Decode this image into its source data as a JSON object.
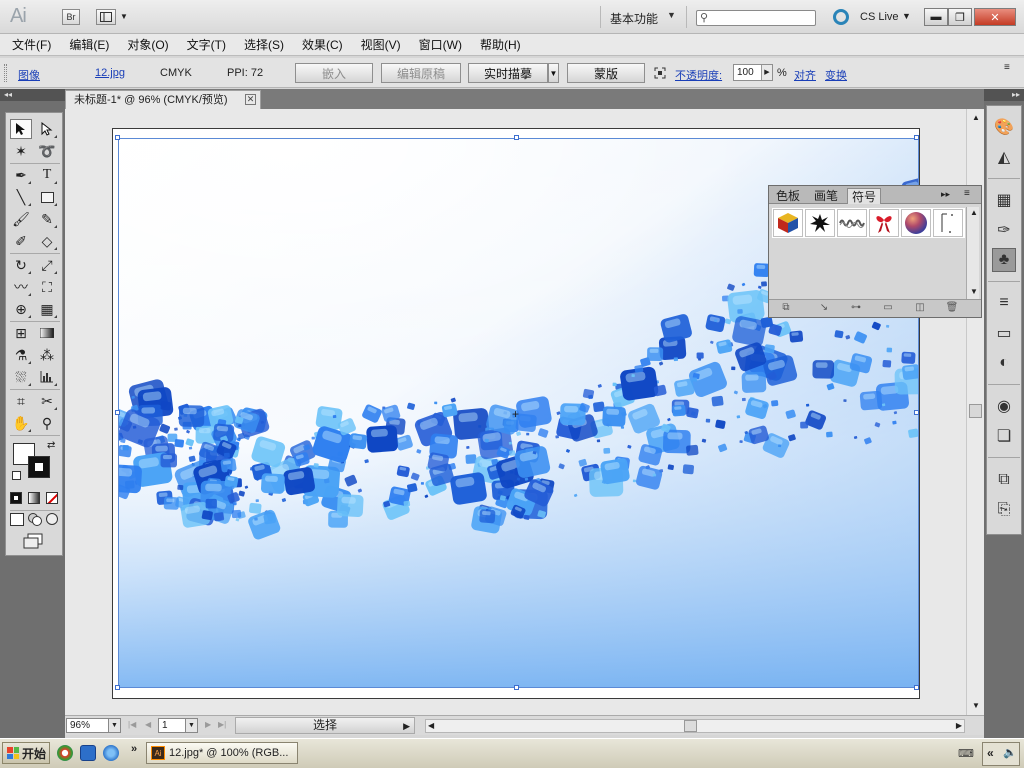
{
  "titlebar": {
    "app_logo": "Ai",
    "bridge_label": "Br",
    "workspace_label": "基本功能",
    "search_placeholder": "",
    "cslive_label": "CS Live"
  },
  "menu": [
    "文件(F)",
    "编辑(E)",
    "对象(O)",
    "文字(T)",
    "选择(S)",
    "效果(C)",
    "视图(V)",
    "窗口(W)",
    "帮助(H)"
  ],
  "control_bar": {
    "object_type": "图像",
    "file_name": "12.jpg",
    "color_mode": "CMYK",
    "ppi": "PPI: 72",
    "embed_label": "嵌入",
    "edit_original_label": "编辑原稿",
    "live_trace_label": "实时描摹",
    "mask_label": "蒙版",
    "opacity_label": "不透明度:",
    "opacity_value": "100",
    "percent": "%",
    "align_label": "对齐",
    "transform_label": "变换"
  },
  "document": {
    "tab_title": "未标题-1* @ 96% (CMYK/预览)"
  },
  "status_bar": {
    "zoom": "96%",
    "page": "1",
    "status_text": "选择"
  },
  "symbol_panel": {
    "tabs": [
      "色板",
      "画笔",
      "符号"
    ],
    "active_tab": "符号",
    "symbols": [
      "cube-symbol",
      "splat-symbol",
      "scribble-symbol",
      "ribbon-symbol",
      "sphere-symbol",
      "note-symbol"
    ]
  },
  "taskbar": {
    "start_label": "开始",
    "task_label": "12.jpg* @ 100% (RGB..."
  },
  "colors": {
    "accent": "#1a3fb8",
    "panel_dark": "#6f6f6f",
    "selection": "#3d6fd0"
  }
}
